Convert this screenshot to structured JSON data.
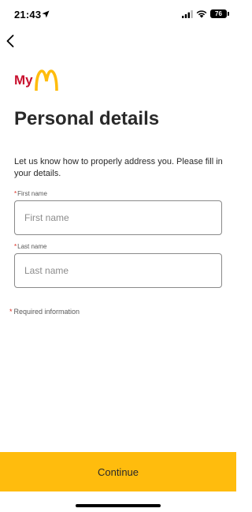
{
  "status_bar": {
    "time": "21:43",
    "battery_level": "76",
    "icons": [
      "location-arrow-icon",
      "cellular-signal-icon",
      "wifi-icon",
      "battery-icon"
    ]
  },
  "nav": {
    "back_icon": "chevron-left-icon"
  },
  "logo": {
    "prefix": "My",
    "mark": "golden-arches",
    "colors": {
      "prefix": "#C8102E",
      "mark": "#FFBC0D"
    }
  },
  "page": {
    "title": "Personal details",
    "intro": "Let us know how to properly address you. Please fill in your details."
  },
  "form": {
    "required_marker": "*",
    "first_name": {
      "label": "First name",
      "placeholder": "First name",
      "value": ""
    },
    "last_name": {
      "label": "Last name",
      "placeholder": "Last name",
      "value": ""
    },
    "required_note": "Required information"
  },
  "footer": {
    "continue_label": "Continue"
  },
  "colors": {
    "accent": "#FFBC0D",
    "required": "#DA291C",
    "text": "#292929",
    "input_border": "#8a8a8a"
  }
}
